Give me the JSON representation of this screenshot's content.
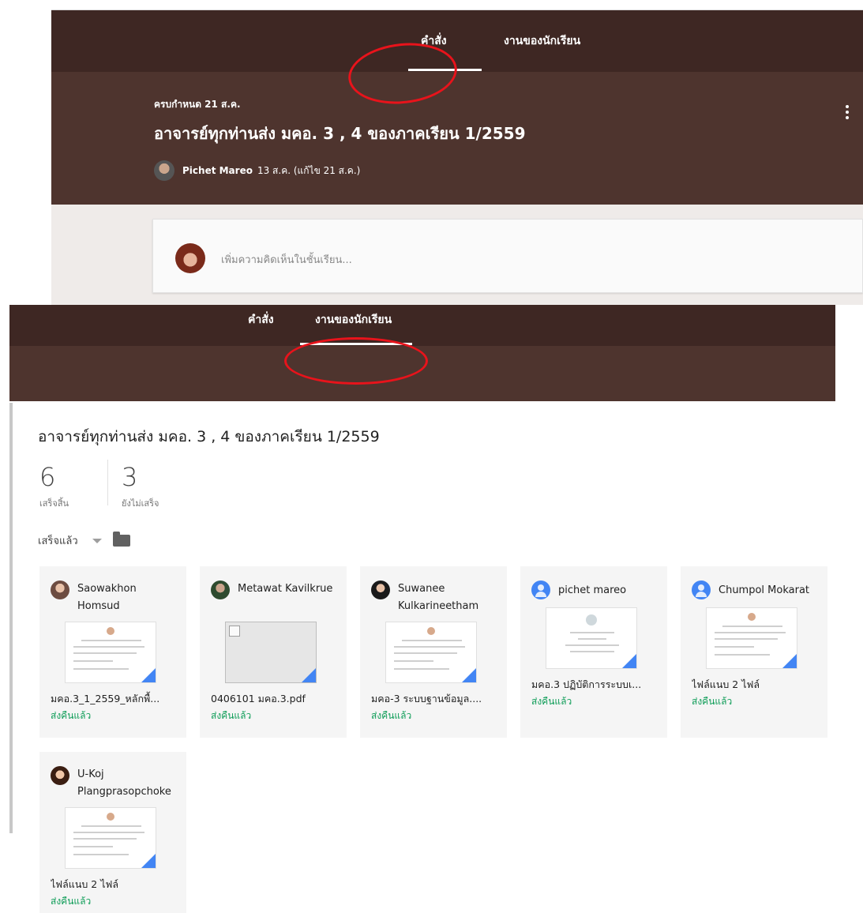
{
  "top": {
    "tabs": [
      "คำสั่ง",
      "งานของนักเรียน"
    ],
    "due": "ครบกำหนด 21 ส.ค.",
    "title": "อาจารย์ทุกท่านส่ง มคอ. 3 , 4 ของภาคเรียน 1/2559",
    "author": "Pichet Mareo",
    "posted": "13 ส.ค. (แก้ไข 21 ส.ค.)",
    "comment_placeholder": "เพิ่มความคิดเห็นในชั้นเรียน..."
  },
  "bottom": {
    "tabs": [
      "คำสั่ง",
      "งานของนักเรียน"
    ],
    "title": "อาจารย์ทุกท่านส่ง มคอ. 3 , 4 ของภาคเรียน 1/2559",
    "stats": [
      {
        "value": "6",
        "label": "เสร็จสิ้น"
      },
      {
        "value": "3",
        "label": "ยังไม่เสร็จ"
      }
    ],
    "filter_label": "เสร็จแล้ว",
    "submissions": [
      {
        "name": "Saowakhon Homsud",
        "file": "มคอ.3_1_2559_หลักพื้...",
        "status": "ส่งคืนแล้ว"
      },
      {
        "name": "Metawat Kavilkrue",
        "file": "0406101 มคอ.3.pdf",
        "status": "ส่งคืนแล้ว"
      },
      {
        "name": "Suwanee Kulkarineetham",
        "file": "มคอ-3 ระบบฐานข้อมูล....",
        "status": "ส่งคืนแล้ว"
      },
      {
        "name": "pichet mareo",
        "file": "มคอ.3 ปฏิบัติการระบบเ...",
        "status": "ส่งคืนแล้ว"
      },
      {
        "name": "Chumpol Mokarat",
        "file": "ไฟล์แนบ 2 ไฟล์",
        "status": "ส่งคืนแล้ว"
      },
      {
        "name": "U-Koj Plangprasopchoke",
        "file": "ไฟล์แนบ 2 ไฟล์",
        "status": "ส่งคืนแล้ว"
      }
    ]
  },
  "colors": {
    "tab_bar": "#3e2723",
    "header": "#4e342e",
    "returned": "#0f9d58",
    "annotation": "#e8131b"
  }
}
